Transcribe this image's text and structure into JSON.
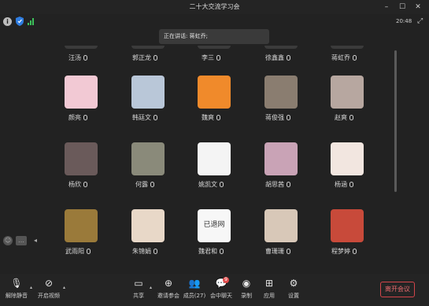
{
  "window": {
    "title": "二十大交流学习会"
  },
  "status": {
    "clock": "20:48"
  },
  "speaking_banner": "正在讲话: 蒋虹乔;",
  "participants": [
    {
      "name": "汪汤",
      "color": "#3b3b3b"
    },
    {
      "name": "郭正龙",
      "color": "#3b3b3b"
    },
    {
      "name": "李三",
      "color": "#3b3b3b"
    },
    {
      "name": "徐鑫鑫",
      "color": "#3b3b3b"
    },
    {
      "name": "蒋虹乔",
      "color": "#3b3b3b"
    },
    {
      "name": "颜亮",
      "color": "#f2c9d4"
    },
    {
      "name": "韩廷文",
      "color": "#b9c7d8"
    },
    {
      "name": "魏爽",
      "color": "#f08a2b"
    },
    {
      "name": "蒋俊强",
      "color": "#8a7d70"
    },
    {
      "name": "赵爽",
      "color": "#b7a7a0"
    },
    {
      "name": "杨欣",
      "color": "#6a5a5a"
    },
    {
      "name": "何露",
      "color": "#8a8a7a"
    },
    {
      "name": "姚凯文",
      "color": "#f4f4f4"
    },
    {
      "name": "胡思茜",
      "color": "#c9a3b6"
    },
    {
      "name": "杨涵",
      "color": "#f2e6e0"
    },
    {
      "name": "武雨阳",
      "color": "#9a7a3a"
    },
    {
      "name": "朱锦娟",
      "color": "#e8d8c8"
    },
    {
      "name": "魏君和",
      "color": "#f7f7f7"
    },
    {
      "name": "曹珊珊",
      "color": "#d8c8b8"
    },
    {
      "name": "程梦婷",
      "color": "#c84a3a"
    }
  ],
  "tile_labels": {
    "withdrawn": "已退网"
  },
  "toolbar": {
    "mute": "解除静音",
    "video": "开启视频",
    "share": "共享",
    "invite": "邀请参会",
    "members": "成员(27)",
    "chat": "会中聊天",
    "chat_badge": "9",
    "record": "录制",
    "apps": "应用",
    "settings": "设置",
    "leave": "离开会议"
  },
  "colors": {
    "leave": "#d2454a",
    "signal": "#3cc15a"
  }
}
